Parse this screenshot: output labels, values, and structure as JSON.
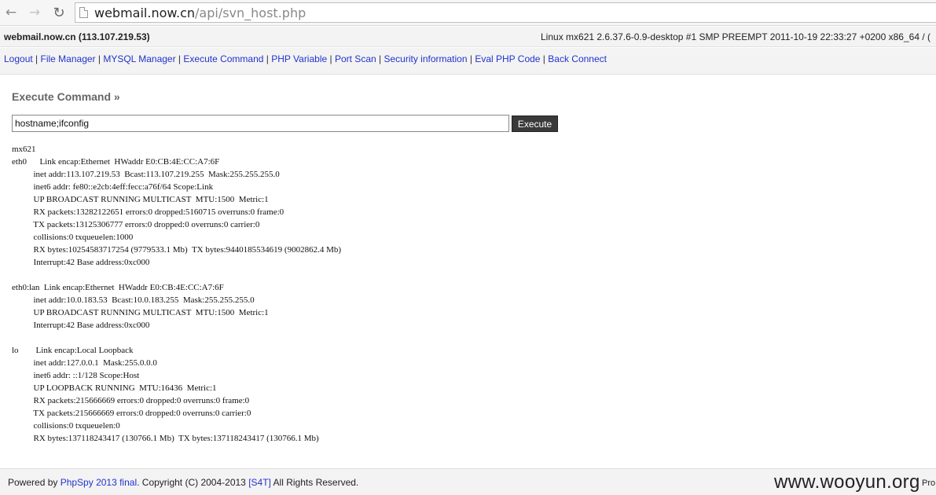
{
  "browser": {
    "url_host": "webmail.now.cn",
    "url_path": "/api/svn_host.php",
    "back_icon": "arrow-left-icon",
    "forward_icon": "arrow-right-icon",
    "reload_icon": "reload-icon"
  },
  "header": {
    "site": "webmail.now.cn (113.107.219.53)",
    "uname": "Linux mx621 2.6.37.6-0.9-desktop #1 SMP PREEMPT 2011-10-19 22:33:27 +0200 x86_64 / ("
  },
  "menu": {
    "items": [
      {
        "label": "Logout"
      },
      {
        "label": "File Manager"
      },
      {
        "label": "MYSQL Manager"
      },
      {
        "label": "Execute Command"
      },
      {
        "label": "PHP Variable"
      },
      {
        "label": "Port Scan"
      },
      {
        "label": "Security information"
      },
      {
        "label": "Eval PHP Code"
      },
      {
        "label": "Back Connect"
      }
    ],
    "separator": " | "
  },
  "main": {
    "title": "Execute Command »",
    "command_value": "hostname;ifconfig",
    "execute_label": "Execute",
    "output": "mx621\neth0      Link encap:Ethernet  HWaddr E0:CB:4E:CC:A7:6F\n          inet addr:113.107.219.53  Bcast:113.107.219.255  Mask:255.255.255.0\n          inet6 addr: fe80::e2cb:4eff:fecc:a76f/64 Scope:Link\n          UP BROADCAST RUNNING MULTICAST  MTU:1500  Metric:1\n          RX packets:13282122651 errors:0 dropped:5160715 overruns:0 frame:0\n          TX packets:13125306777 errors:0 dropped:0 overruns:0 carrier:0\n          collisions:0 txqueuelen:1000\n          RX bytes:10254583717254 (9779533.1 Mb)  TX bytes:9440185534619 (9002862.4 Mb)\n          Interrupt:42 Base address:0xc000\n\neth0:lan  Link encap:Ethernet  HWaddr E0:CB:4E:CC:A7:6F\n          inet addr:10.0.183.53  Bcast:10.0.183.255  Mask:255.255.255.0\n          UP BROADCAST RUNNING MULTICAST  MTU:1500  Metric:1\n          Interrupt:42 Base address:0xc000\n\nlo        Link encap:Local Loopback\n          inet addr:127.0.0.1  Mask:255.0.0.0\n          inet6 addr: ::1/128 Scope:Host\n          UP LOOPBACK RUNNING  MTU:16436  Metric:1\n          RX packets:215666669 errors:0 dropped:0 overruns:0 frame:0\n          TX packets:215666669 errors:0 dropped:0 overruns:0 carrier:0\n          collisions:0 txqueuelen:0\n          RX bytes:137118243417 (130766.1 Mb)  TX bytes:137118243417 (130766.1 Mb)"
  },
  "footer": {
    "powered_by": "Powered by ",
    "product_link": "PhpSpy 2013 final",
    "copyright": ". Copyright (C) 2004-2013 ",
    "team_link": "[S4T]",
    "rights": " All Rights Reserved.",
    "watermark": "www.wooyun.org",
    "clipped_text": "Pro"
  }
}
